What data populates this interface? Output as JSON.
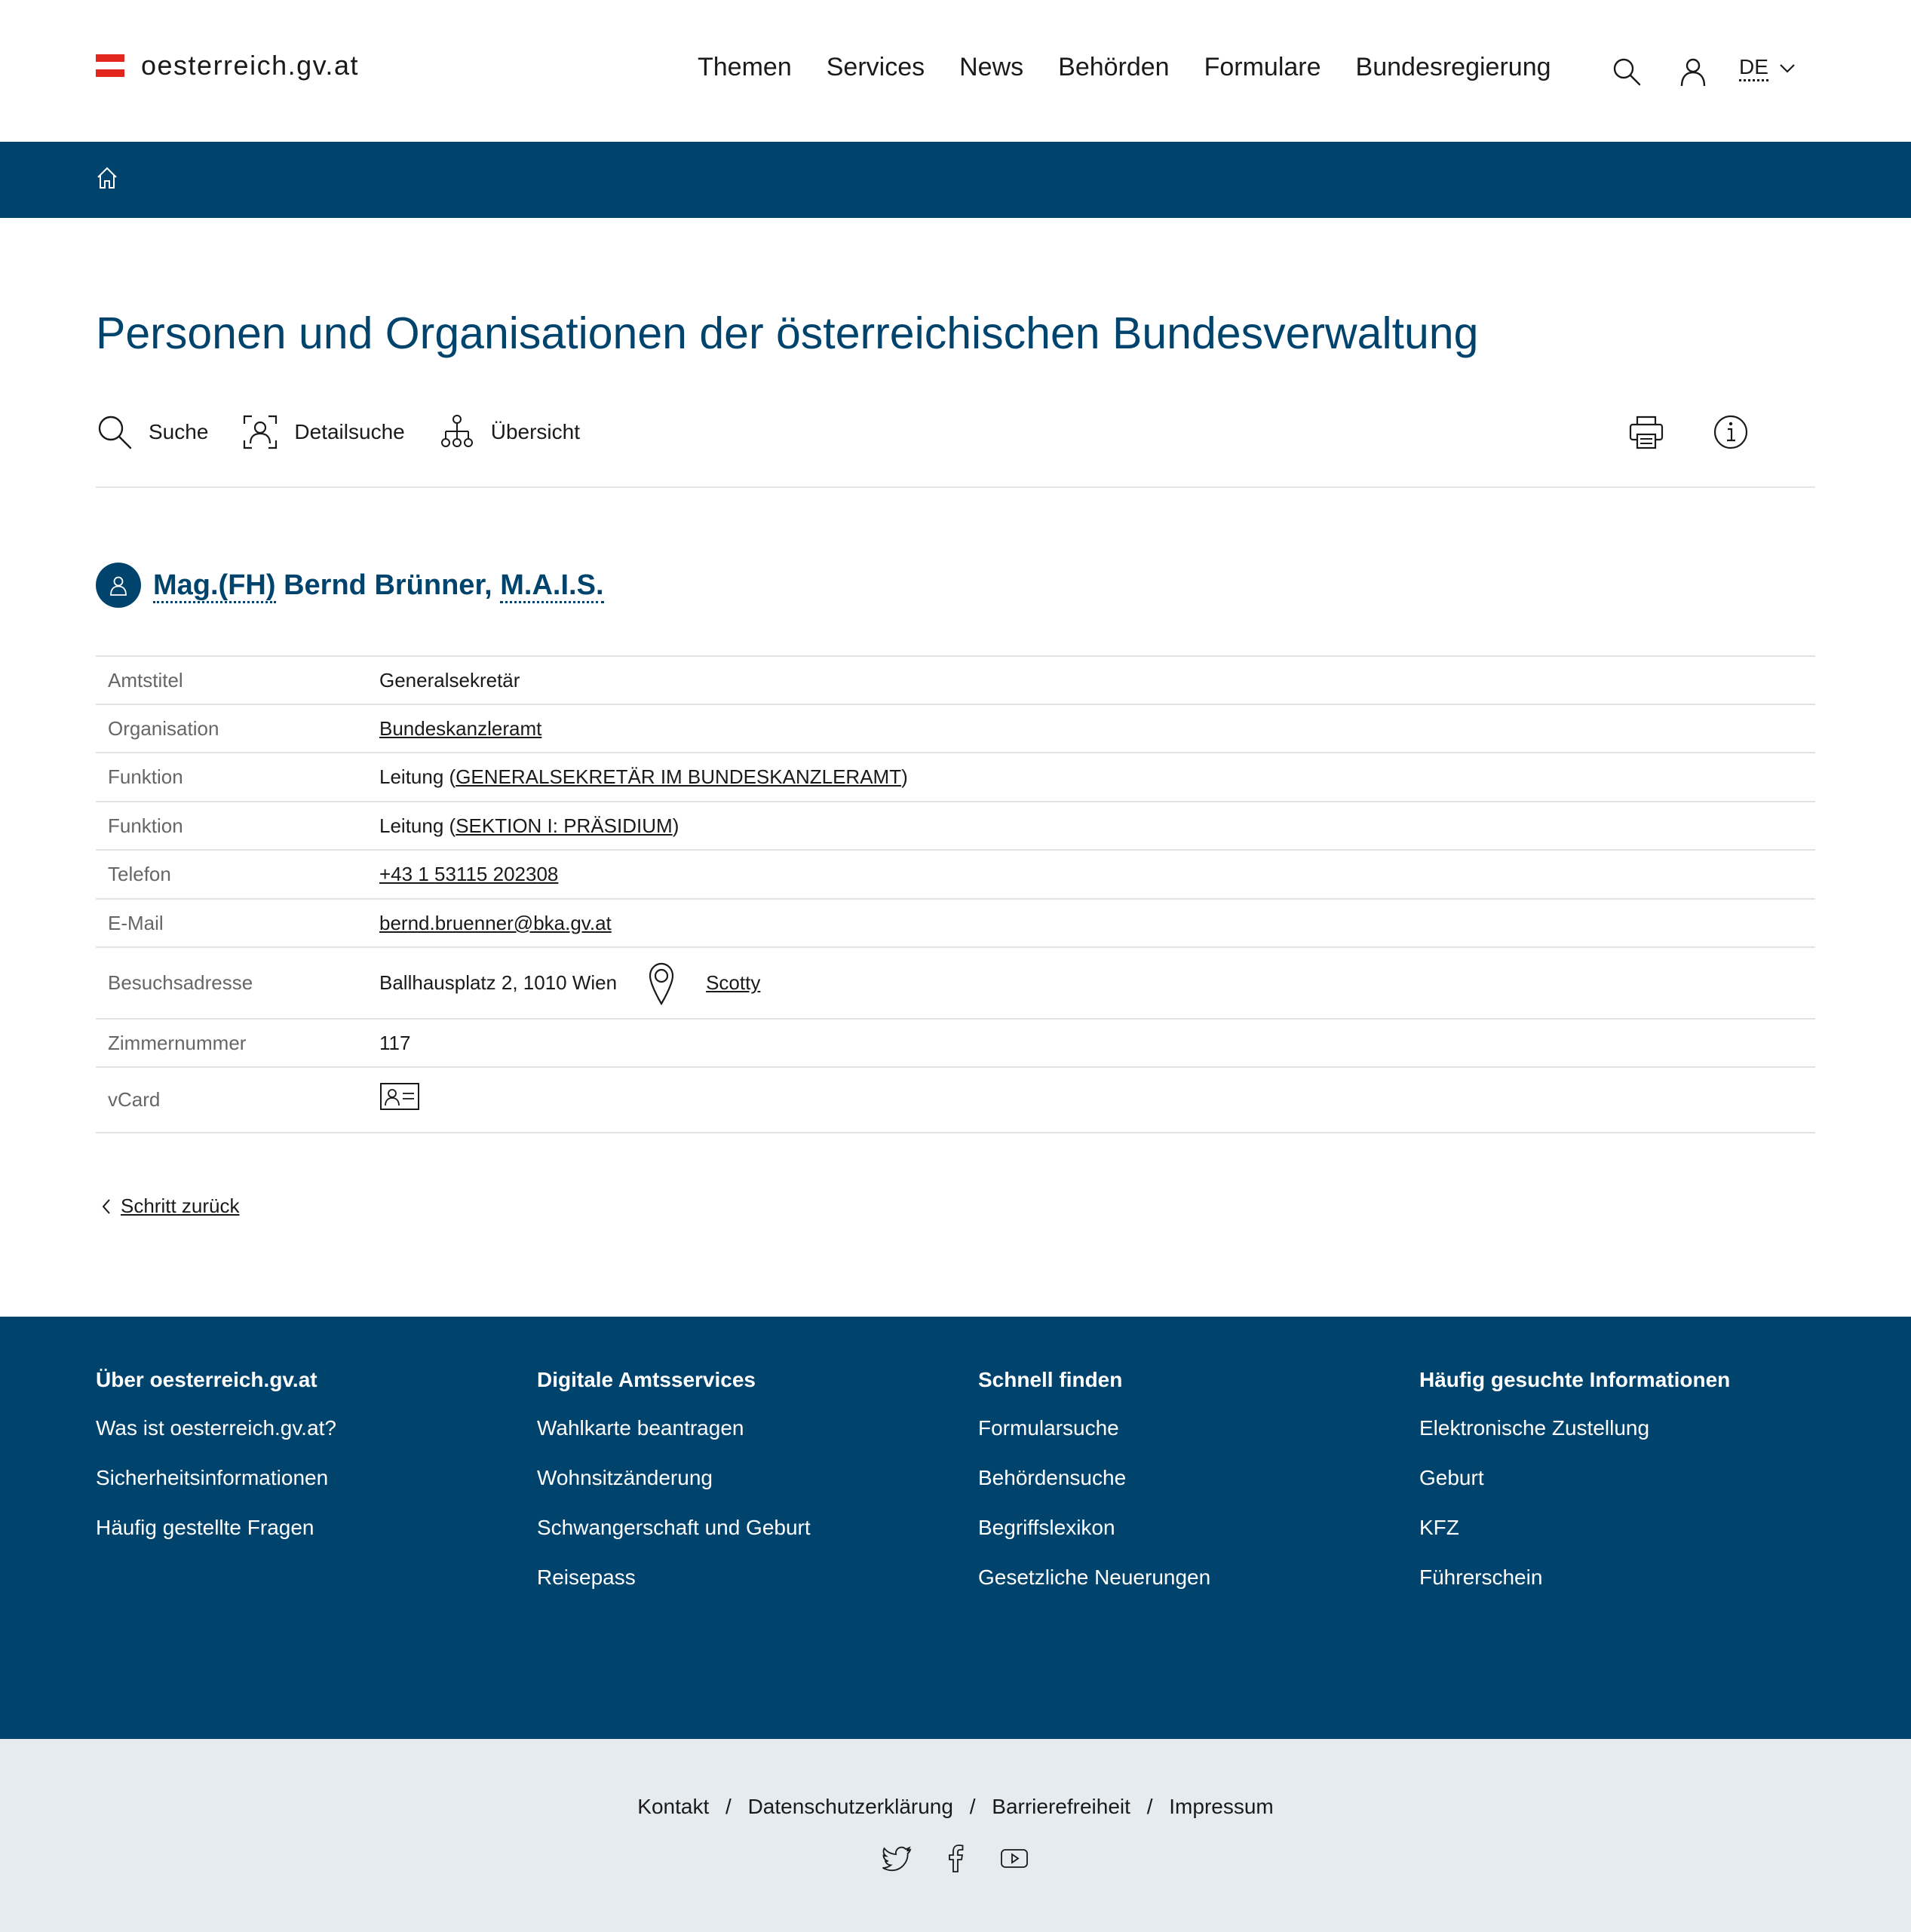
{
  "header": {
    "logo_text": "oesterreich.gv.at",
    "nav": [
      "Themen",
      "Services",
      "News",
      "Behörden",
      "Formulare",
      "Bundesregierung"
    ],
    "language": "DE"
  },
  "page": {
    "title": "Personen und Organisationen der österreichischen Bundesverwaltung",
    "tools": {
      "search": "Suche",
      "detail_search": "Detailsuche",
      "overview": "Übersicht"
    }
  },
  "person": {
    "title_prefix": "Mag.(FH)",
    "name": "Bernd Brünner,",
    "title_suffix": "M.A.I.S."
  },
  "details": {
    "amtstitel_label": "Amtstitel",
    "amtstitel": "Generalsekretär",
    "organisation_label": "Organisation",
    "organisation": "Bundeskanzleramt",
    "funktion_label": "Funktion",
    "funktion1_prefix": "Leitung (",
    "funktion1_link": "GENERALSEKRETÄR IM BUNDESKANZLERAMT",
    "funktion2_prefix": "Leitung (",
    "funktion2_link": "SEKTION I: PRÄSIDIUM",
    "close_paren": ")",
    "telefon_label": "Telefon",
    "telefon": "+43 1 53115 202308",
    "email_label": "E-Mail",
    "email": "bernd.bruenner@bka.gv.at",
    "adresse_label": "Besuchsadresse",
    "adresse": "Ballhausplatz 2, 1010 Wien",
    "map_link": "Scotty",
    "zimmer_label": "Zimmernummer",
    "zimmer": "117",
    "vcard_label": "vCard"
  },
  "back_link": "Schritt zurück",
  "footer": {
    "col1": {
      "title": "Über oesterreich.gv.at",
      "links": [
        "Was ist oesterreich.gv.at?",
        "Sicherheitsinformationen",
        "Häufig gestellte Fragen"
      ]
    },
    "col2": {
      "title": "Digitale Amtsservices",
      "links": [
        "Wahlkarte beantragen",
        "Wohnsitzänderung",
        "Schwangerschaft und Geburt",
        "Reisepass"
      ]
    },
    "col3": {
      "title": "Schnell finden",
      "links": [
        "Formularsuche",
        "Behördensuche",
        "Begriffslexikon",
        "Gesetzliche Neuerungen"
      ]
    },
    "col4": {
      "title": "Häufig gesucht​e Informationen",
      "links": [
        "Elektronische Zustellung",
        "Geburt",
        "KFZ",
        "Führerschein"
      ]
    }
  },
  "legal": {
    "links": [
      "Kontakt",
      "Datenschutzerklärung",
      "Barrierefreiheit",
      "Impressum"
    ],
    "separator": "/"
  },
  "colors": {
    "brand_blue": "#00446e",
    "flag_red": "#e4271e",
    "subfooter_bg": "#e6ebef"
  }
}
